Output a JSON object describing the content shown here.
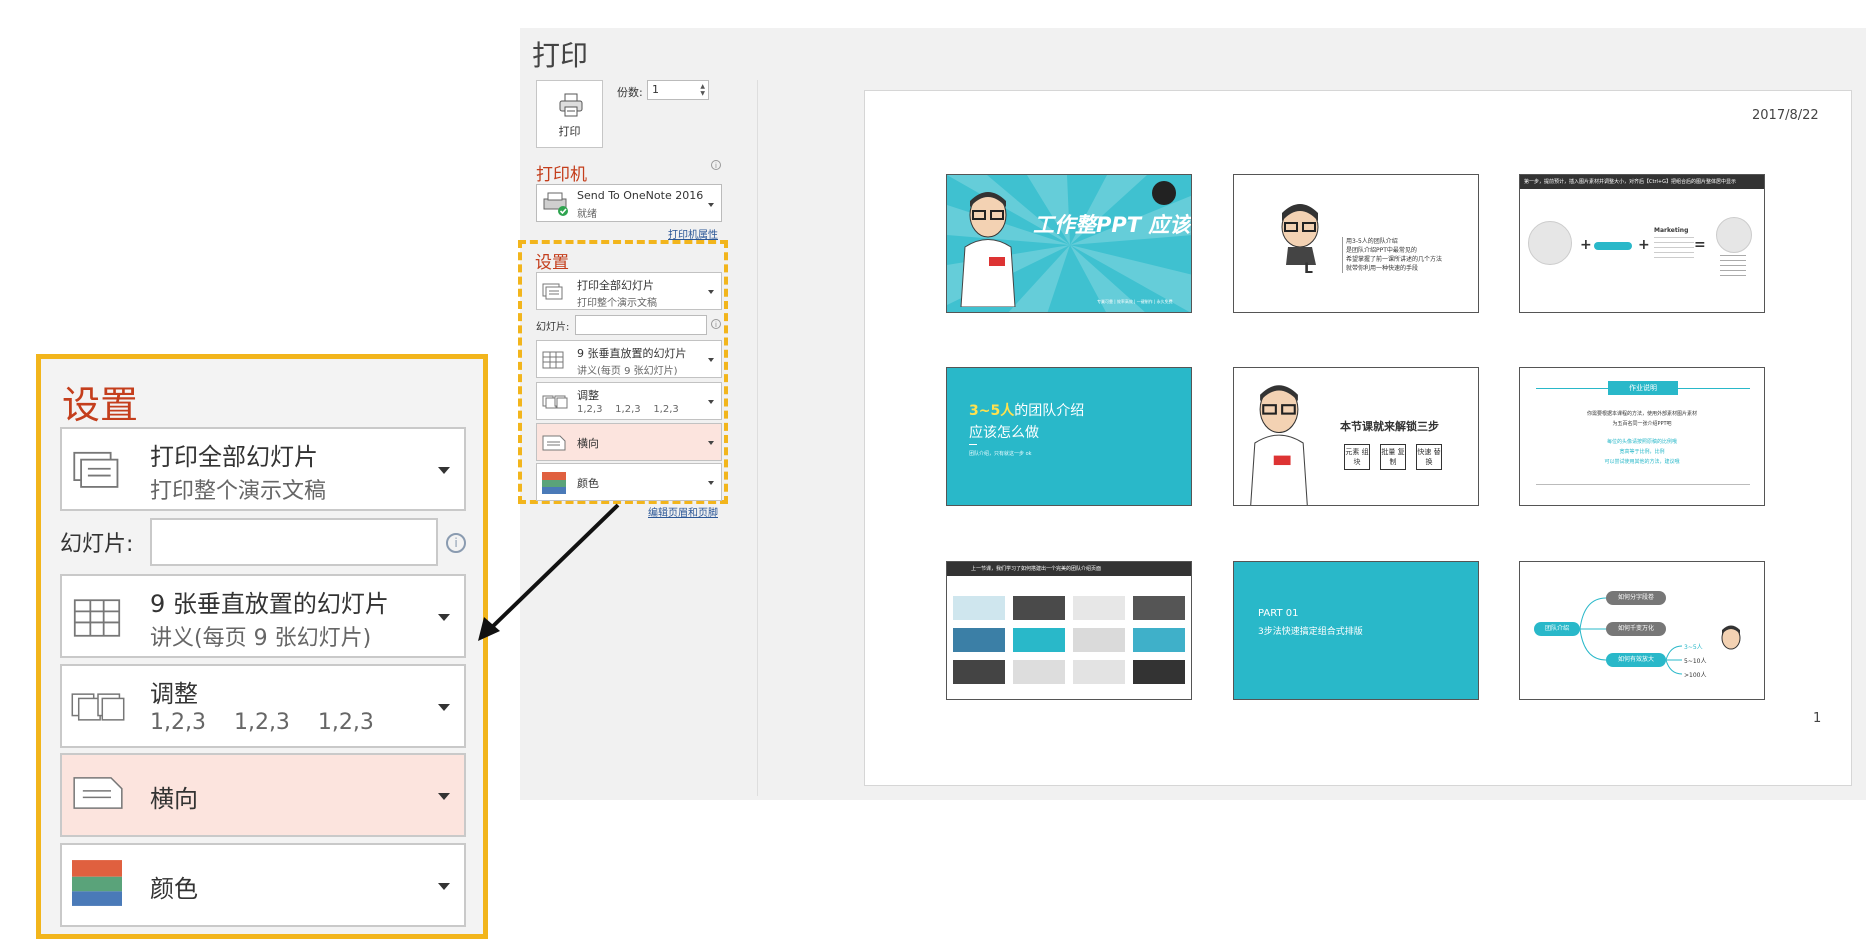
{
  "print_panel": {
    "title": "打印",
    "print_button": "打印",
    "copies_label": "份数:",
    "copies_value": "1",
    "printer_heading": "打印机",
    "printer_name": "Send To OneNote 2016",
    "printer_status": "就绪",
    "printer_properties_link": "打印机属性",
    "settings_heading": "设置",
    "print_range": {
      "main": "打印全部幻灯片",
      "sub": "打印整个演示文稿"
    },
    "slides_label": "幻灯片:",
    "slides_value": "",
    "layout": {
      "main": "9 张垂直放置的幻灯片",
      "sub": "讲义(每页 9 张幻灯片)"
    },
    "collate": {
      "main": "调整",
      "sub": "1,2,3    1,2,3    1,2,3"
    },
    "orientation": {
      "main": "横向"
    },
    "color": {
      "main": "颜色"
    },
    "edit_header_footer_link": "编辑页眉和页脚"
  },
  "preview": {
    "date": "2017/8/22",
    "page_number": "1",
    "slides": [
      {
        "title": "工作整PPT 应该这样做",
        "footer": "专業可靠 | 效率高效 | 一键制作 | 永久免费"
      },
      {
        "lines": [
          "用3-5人的团队介绍",
          "是团队介绍PPT中最常见的",
          "希望掌握了前一课所讲述的几个方法",
          "就带你利用一种快速的手段"
        ],
        "badge": "L"
      },
      {
        "header": "第一步，提前预计，插入图片素材并调整大小，对齐后【Ctrl+G】把组合后的图片整体居中显示",
        "label": "Marketing"
      },
      {
        "highlight": "3~5人",
        "title_rest": "的团队介绍",
        "title_line2": "应该怎么做",
        "small": "团队介绍，只有就这一步 ok"
      },
      {
        "heading": "本节课就来解锁三步",
        "steps": [
          "元素 组块",
          "批量 复制",
          "快速 替换"
        ]
      },
      {
        "banner": "作业说明",
        "line1": "你需要根据本课程的方法，使用外部素材图片素材",
        "line2": "为五百名同一张介绍PPT吧",
        "hint1": "每位的头像请按照原稿的比例哦",
        "hint2": "宽高等于比例，比例",
        "hint3": "可以尝试使用其他的方法，建议哦"
      },
      {
        "header": "上一节课，我们学习了如何搭建出一个完美的团队介绍页面"
      },
      {
        "part": "PART 01",
        "subtitle": "3步法快速搞定组合式排版"
      },
      {
        "center": "团队介绍",
        "nodes": [
          "如何分字段卷",
          "如何千变万化",
          "如何有效放大"
        ],
        "counts": [
          "3~5人",
          "5~10人",
          ">100人"
        ]
      }
    ]
  },
  "zoom": {
    "settings_heading": "设置",
    "print_range": {
      "main": "打印全部幻灯片",
      "sub": "打印整个演示文稿"
    },
    "slides_label": "幻灯片:",
    "layout": {
      "main": "9 张垂直放置的幻灯片",
      "sub": "讲义(每页 9 张幻灯片)"
    },
    "collate": {
      "main": "调整",
      "sub": "1,2,3    1,2,3    1,2,3"
    },
    "orientation": {
      "main": "横向"
    },
    "color": {
      "main": "颜色"
    }
  },
  "colors": {
    "accent_red": "#c43e1c",
    "highlight_yellow": "#f2b51c",
    "teal": "#29b8c9",
    "orientation_bg": "#fce4de"
  }
}
